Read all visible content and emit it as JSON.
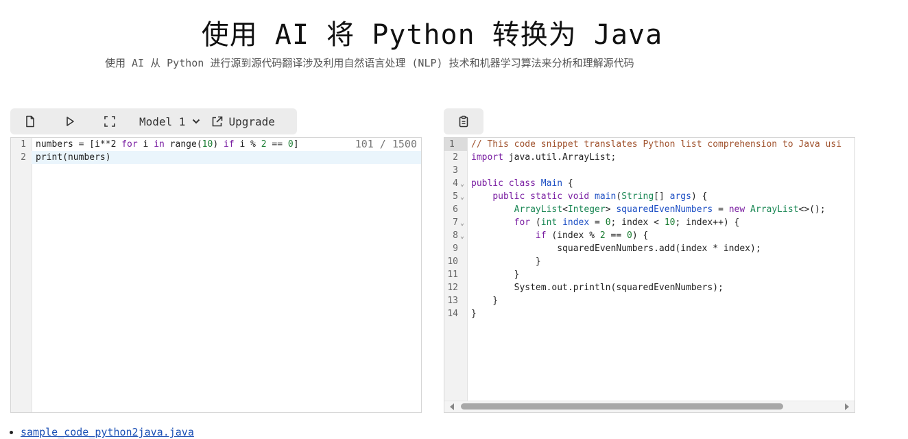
{
  "header": {
    "title": "使用 AI 将 Python 转换为 Java",
    "subtitle": "使用 AI 从 Python 进行源到源代码翻译涉及利用自然语言处理 (NLP) 技术和机器学习算法来分析和理解源代码"
  },
  "left_toolbar": {
    "model_label": "Model 1",
    "upgrade_label": "Upgrade"
  },
  "input_editor": {
    "counter": "101 / 1500",
    "line_numbers": [
      "1",
      "2"
    ],
    "lines": [
      "numbers = [i**2 for i in range(10) if i % 2 == 0]",
      "print(numbers)"
    ]
  },
  "output_editor": {
    "line_numbers": [
      "1",
      "2",
      "3",
      "4",
      "5",
      "6",
      "7",
      "8",
      "9",
      "10",
      "11",
      "12",
      "13",
      "14"
    ],
    "lines": [
      "// This code snippet translates Python list comprehension to Java usi",
      "import java.util.ArrayList;",
      "",
      "public class Main {",
      "    public static void main(String[] args) {",
      "        ArrayList<Integer> squaredEvenNumbers = new ArrayList<>();",
      "        for (int index = 0; index < 10; index++) {",
      "            if (index % 2 == 0) {",
      "                squaredEvenNumbers.add(index * index);",
      "            }",
      "        }",
      "        System.out.println(squaredEvenNumbers);",
      "    }",
      "}"
    ]
  },
  "links": [
    {
      "label": "sample_code_python2java.java"
    }
  ]
}
